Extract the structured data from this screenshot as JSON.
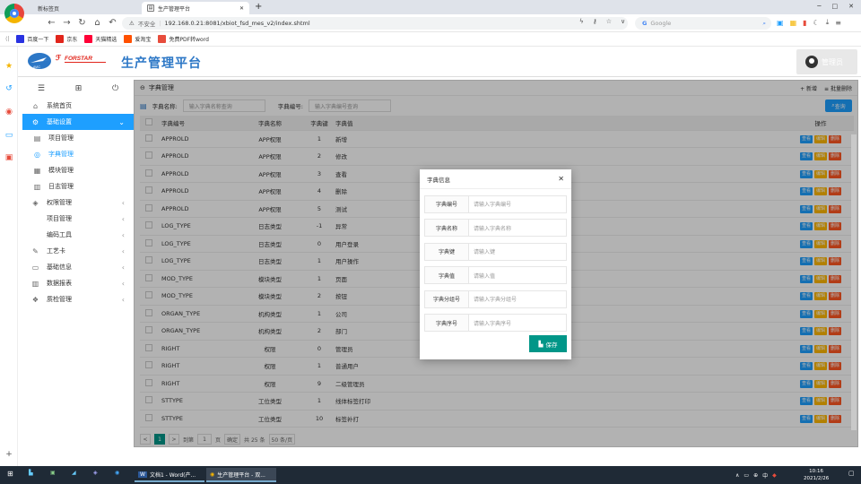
{
  "browser": {
    "tabs": [
      {
        "label": "新标签页"
      },
      {
        "label": "生产管理平台"
      }
    ],
    "new_tab": "+",
    "security": "不安全",
    "url": "192.168.0.21:8081/xbiot_fsd_mes_v2/index.shtml",
    "search_engine": "Google",
    "window_controls": [
      "─",
      "□",
      "✕"
    ],
    "bookmarks": [
      {
        "label": "百度一下",
        "color": "#2932e1"
      },
      {
        "label": "京东",
        "color": "#e1251b"
      },
      {
        "label": "天猫精选",
        "color": "#ff0036"
      },
      {
        "label": "爱淘宝",
        "color": "#ff5000"
      },
      {
        "label": "免费PDF转word",
        "color": "#e74c3c"
      }
    ]
  },
  "app": {
    "logo_text": "FORSTAR",
    "logo_sub": "AVIC",
    "title": "生产管理平台",
    "user": "管理员"
  },
  "sidebar": {
    "tools": [
      "☰",
      "⊞",
      "⏻"
    ],
    "items": [
      {
        "label": "系统首页",
        "icon": "⌂",
        "type": "item"
      },
      {
        "label": "基础设置",
        "icon": "⚙",
        "type": "group"
      },
      {
        "label": "项目管理",
        "icon": "▤",
        "type": "sub"
      },
      {
        "label": "字典管理",
        "icon": "◎",
        "type": "sub active"
      },
      {
        "label": "模块管理",
        "icon": "▦",
        "type": "sub"
      },
      {
        "label": "日志管理",
        "icon": "▥",
        "type": "sub"
      },
      {
        "label": "权限管理",
        "icon": "◈",
        "type": "item chev"
      },
      {
        "label": "项目管理",
        "icon": "",
        "type": "item chev"
      },
      {
        "label": "编码工具",
        "icon": "",
        "type": "item chev"
      },
      {
        "label": "工艺卡",
        "icon": "✎",
        "type": "item chev"
      },
      {
        "label": "基础信息",
        "icon": "▭",
        "type": "item chev"
      },
      {
        "label": "数据报表",
        "icon": "▥",
        "type": "item chev"
      },
      {
        "label": "质检管理",
        "icon": "❖",
        "type": "item chev"
      }
    ]
  },
  "main": {
    "title": "字典管理",
    "add": "新增",
    "batch_delete": "批量删除",
    "search": {
      "name_label": "字典名称:",
      "name_placeholder": "输入字典名称查询",
      "code_label": "字典编号:",
      "code_placeholder": "输入字典编号查询",
      "button": "查询"
    },
    "columns": [
      "字典编号",
      "字典名称",
      "字典键",
      "字典值",
      "操作"
    ],
    "actions": {
      "view": "查看",
      "edit": "编辑",
      "delete": "删除"
    },
    "rows": [
      [
        "APPROLD",
        "APP权限",
        "1",
        "新增"
      ],
      [
        "APPROLD",
        "APP权限",
        "2",
        "修改"
      ],
      [
        "APPROLD",
        "APP权限",
        "3",
        "查看"
      ],
      [
        "APPROLD",
        "APP权限",
        "4",
        "删除"
      ],
      [
        "APPROLD",
        "APP权限",
        "5",
        "测试"
      ],
      [
        "LOG_TYPE",
        "日志类型",
        "-1",
        "异常"
      ],
      [
        "LOG_TYPE",
        "日志类型",
        "0",
        "用户登录"
      ],
      [
        "LOG_TYPE",
        "日志类型",
        "1",
        "用户操作"
      ],
      [
        "MOD_TYPE",
        "模块类型",
        "1",
        "页面"
      ],
      [
        "MOD_TYPE",
        "模块类型",
        "2",
        "按钮"
      ],
      [
        "ORGAN_TYPE",
        "机构类型",
        "1",
        "公司"
      ],
      [
        "ORGAN_TYPE",
        "机构类型",
        "2",
        "部门"
      ],
      [
        "RIGHT",
        "权限",
        "0",
        "管理员"
      ],
      [
        "RIGHT",
        "权限",
        "1",
        "普通用户"
      ],
      [
        "RIGHT",
        "权限",
        "9",
        "二级管理员"
      ],
      [
        "STTYPE",
        "工位类型",
        "1",
        "线体标签打印"
      ],
      [
        "STTYPE",
        "工位类型",
        "10",
        "标签补打"
      ]
    ],
    "pager": {
      "prev": "<",
      "page": "1",
      "next": ">",
      "goto": "到第",
      "input": "1",
      "unit": "页",
      "confirm": "确定",
      "total": "共 25 条",
      "size": "50 条/页"
    }
  },
  "modal": {
    "title": "字典信息",
    "close": "✕",
    "fields": [
      {
        "label": "字典编号",
        "placeholder": "请输入字典编号"
      },
      {
        "label": "字典名称",
        "placeholder": "请输入字典名称"
      },
      {
        "label": "字典键",
        "placeholder": "请输入键"
      },
      {
        "label": "字典值",
        "placeholder": "请输入值"
      },
      {
        "label": "字典分组号",
        "placeholder": "请输入字典分组号"
      },
      {
        "label": "字典序号",
        "placeholder": "请输入字典序号"
      }
    ],
    "save": "保存"
  },
  "taskbar": {
    "apps": [
      {
        "label": "文档1 - Word(产..."
      },
      {
        "label": "生产管理平台 - 双..."
      }
    ],
    "ime": "中",
    "time": "10:16",
    "date": "2021/2/26"
  }
}
